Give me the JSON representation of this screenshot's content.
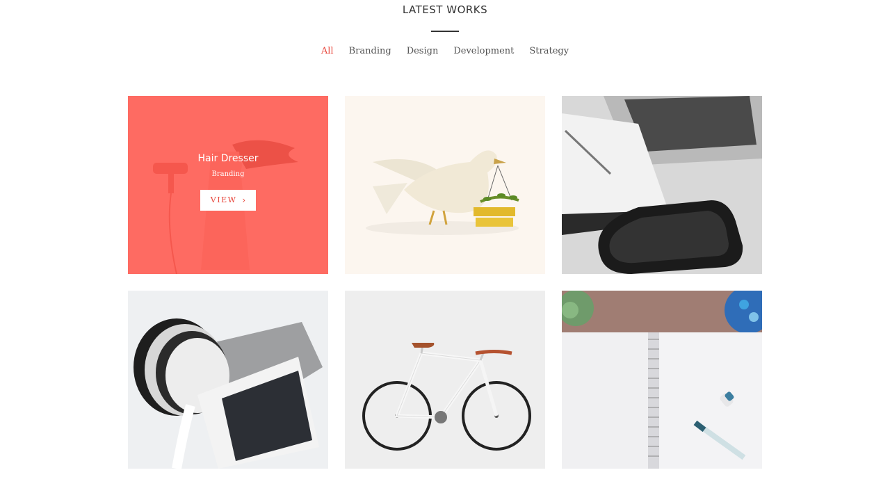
{
  "section": {
    "title": "LATEST WORKS"
  },
  "filters": [
    {
      "label": "All",
      "active": true
    },
    {
      "label": "Branding",
      "active": false
    },
    {
      "label": "Design",
      "active": false
    },
    {
      "label": "Development",
      "active": false
    },
    {
      "label": "Strategy",
      "active": false
    }
  ],
  "portfolio": {
    "hovered_item": {
      "title": "Hair Dresser",
      "category": "Branding",
      "view_label": "VIEW",
      "chevron_icon": "chevron-right-icon"
    },
    "items": [
      {
        "image": "hair-dresser-photo"
      },
      {
        "image": "dove-illustration"
      },
      {
        "image": "laptop-notebook-phone-photo"
      },
      {
        "image": "camera-photo"
      },
      {
        "image": "bicycle-photo"
      },
      {
        "image": "sketchbook-desk-photo"
      }
    ]
  },
  "colors": {
    "accent": "#e8473c",
    "overlay": "#ff5a50",
    "text": "#444444"
  }
}
